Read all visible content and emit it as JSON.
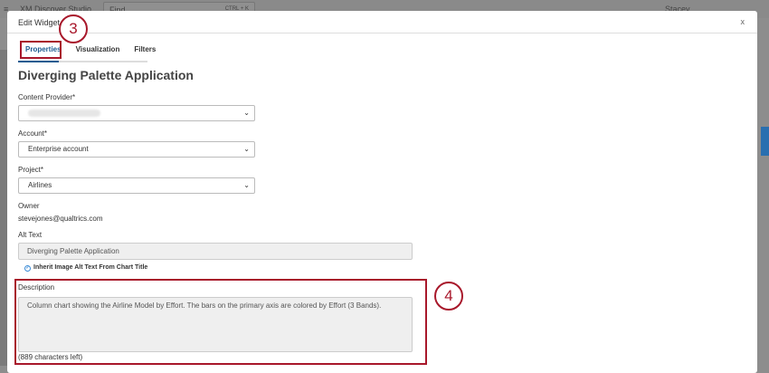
{
  "background": {
    "app_name": "XM Discover Studio",
    "search_placeholder": "Find",
    "search_shortcut": "CTRL + K",
    "user": "Stacey"
  },
  "modal": {
    "title": "Edit Widget",
    "close_label": "x",
    "tabs": [
      {
        "label": "Properties",
        "active": true
      },
      {
        "label": "Visualization"
      },
      {
        "label": "Filters"
      }
    ],
    "heading": "Diverging Palette Application",
    "content_provider": {
      "label": "Content Provider*",
      "value": ""
    },
    "account": {
      "label": "Account*",
      "value": "Enterprise account"
    },
    "project": {
      "label": "Project*",
      "value": "Airlines"
    },
    "owner": {
      "label": "Owner",
      "value": "stevejones@qualtrics.com"
    },
    "alt_text": {
      "label": "Alt Text",
      "value": "Diverging Palette Application"
    },
    "inherit_checkbox": {
      "label": "Inherit Image Alt Text From Chart Title",
      "checked": true
    },
    "description": {
      "label": "Description",
      "value": "Column chart showing the Airline Model by Effort. The bars on the primary axis are colored by Effort (3 Bands).",
      "chars_left": "(889 characters left)"
    }
  },
  "callouts": {
    "step3": "3",
    "step4": "4"
  },
  "colors": {
    "accent": "#1f5c91",
    "callout": "#a8182b"
  }
}
